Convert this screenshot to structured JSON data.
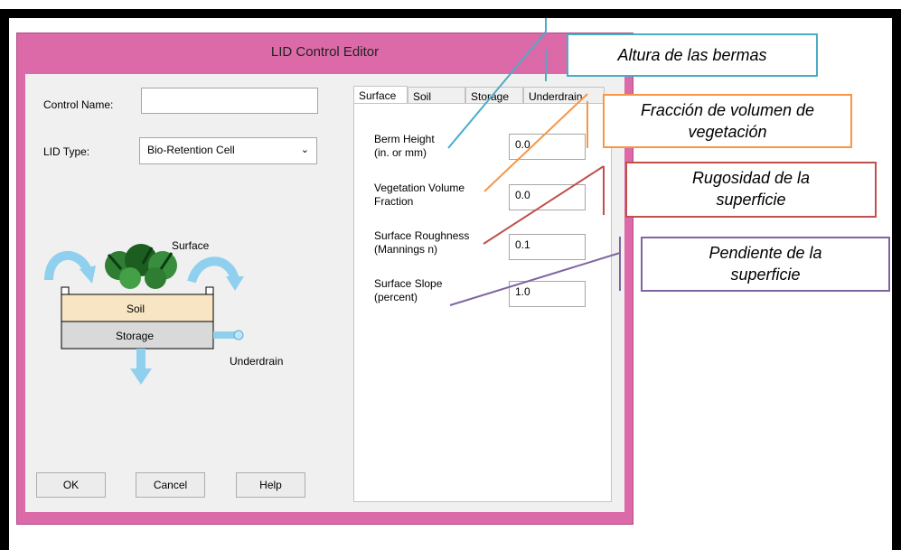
{
  "page": {
    "top_caption": "",
    "window": {
      "title": "LID Control Editor",
      "control_name_label": "Control Name:",
      "control_name_value": "",
      "lid_type_label": "LID Type:",
      "lid_type_value": "Bio-Retention Cell",
      "diagram": {
        "surface_label": "Surface",
        "soil_label": "Soil",
        "storage_label": "Storage",
        "underdrain_label": "Underdrain"
      },
      "buttons": {
        "ok": "OK",
        "cancel": "Cancel",
        "help": "Help"
      },
      "tabs": [
        {
          "label": "Surface",
          "active": true
        },
        {
          "label": "Soil",
          "active": false
        },
        {
          "label": "Storage",
          "active": false
        },
        {
          "label": "Underdrain",
          "active": false
        }
      ],
      "fields": {
        "berm_height": {
          "label1": "Berm Height",
          "label2": "(in. or mm)",
          "value": "0.0"
        },
        "vegetation_volume_fraction": {
          "label1": "Vegetation Volume",
          "label2": "Fraction",
          "value": "0.0"
        },
        "surface_roughness": {
          "label1": "Surface Roughness",
          "label2": "(Mannings n)",
          "value": "0.1"
        },
        "surface_slope": {
          "label1": "Surface Slope",
          "label2": "(percent)",
          "value": "1.0"
        }
      }
    },
    "callouts": {
      "berm": {
        "text": "Altura de las bermas",
        "color": "#4bacc6"
      },
      "vegetation": {
        "text1": "Fracción de volumen de",
        "text2": "vegetación",
        "color": "#f79646"
      },
      "roughness": {
        "text1": "Rugosidad de la",
        "text2": "superficie",
        "color": "#c0504d"
      },
      "slope": {
        "text1": "Pendiente de la",
        "text2": "superficie",
        "color": "#8064a2"
      }
    },
    "colors": {
      "window_frame": "#dc6aa8",
      "window_client": "#f0f0f0",
      "outer_frame": "#000000"
    }
  }
}
